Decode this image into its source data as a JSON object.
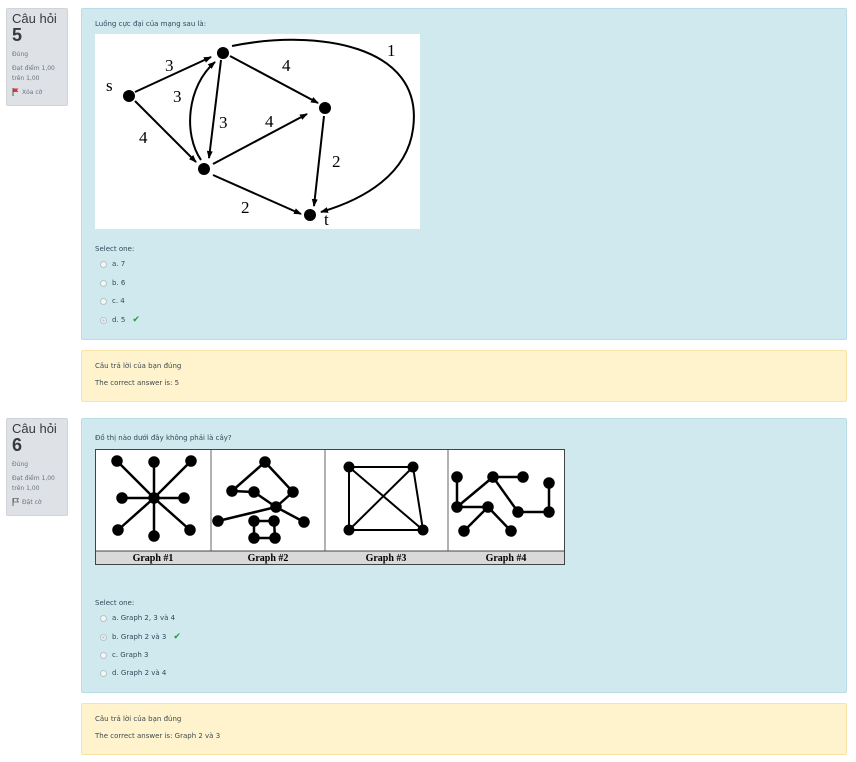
{
  "q5": {
    "label": "Câu hỏi",
    "number": "5",
    "status": "Đúng",
    "score_line1": "Đạt điểm 1,00",
    "score_line2": "trên 1,00",
    "flag_label": "Xóa cờ",
    "text": "Luồng cực đại của mạng sau là:",
    "graph_labels": {
      "s": "s",
      "t": "t",
      "e1": "3",
      "e2": "3",
      "e3": "4",
      "e4": "3",
      "e5": "4",
      "e6": "4",
      "e7": "2",
      "e8": "2",
      "e9": "1"
    },
    "select_label": "Select one:",
    "options": [
      {
        "label": "a. 7",
        "checked": false
      },
      {
        "label": "b. 6",
        "checked": false
      },
      {
        "label": "c. 4",
        "checked": false
      },
      {
        "label": "d. 5",
        "checked": true
      }
    ],
    "feedback": {
      "line1": "Câu trả lời của bạn đúng",
      "line2": "The correct answer is: 5"
    }
  },
  "q6": {
    "label": "Câu hỏi",
    "number": "6",
    "status": "Đúng",
    "score_line1": "Đạt điểm 1,00",
    "score_line2": "trên 1,00",
    "flag_label": "Đặt cờ",
    "text": "Đồ thị nào dưới đây không phải là cây?",
    "graph_captions": [
      "Graph #1",
      "Graph #2",
      "Graph #3",
      "Graph #4"
    ],
    "select_label": "Select one:",
    "options": [
      {
        "label": "a. Graph 2, 3 và 4",
        "checked": false
      },
      {
        "label": "b. Graph 2 và 3",
        "checked": true
      },
      {
        "label": "c. Graph 3",
        "checked": false
      },
      {
        "label": "d. Graph 2 và 4",
        "checked": false
      }
    ],
    "feedback": {
      "line1": "Câu trả lời của bạn đúng",
      "line2": "The correct answer is: Graph 2 và 3"
    }
  },
  "colors": {
    "content_bg": "#cfe9ef",
    "feedback_bg": "#fff3cd",
    "info_bg": "#dee2e6",
    "check": "#1e9e3c",
    "flag_red": "#d9373c"
  },
  "icons": {
    "flag_q5": "flag-filled-red-icon",
    "flag_q6": "flag-outline-icon",
    "correct": "check-icon"
  }
}
